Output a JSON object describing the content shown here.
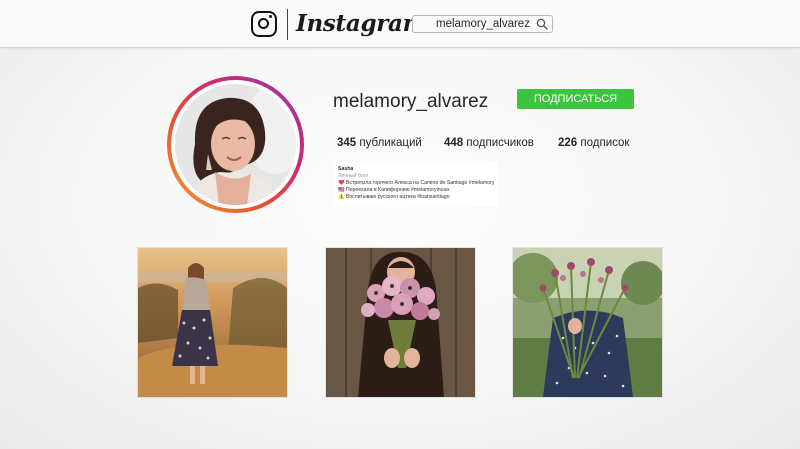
{
  "header": {
    "logo_icon": "instagram-camera-icon",
    "wordmark": "Instagram",
    "search": {
      "value": "melamory_alvarez",
      "icon": "search-icon"
    }
  },
  "profile": {
    "username": "melamory_alvarez",
    "follow_label": "ПОДПИСАТЬСЯ",
    "follow_color": "#3cc43f",
    "avatar_ring_colors": [
      "#f3a13b",
      "#e8542f",
      "#cf2872",
      "#8e3ab2"
    ],
    "stats": {
      "posts_count": "345",
      "posts_label": "публикаций",
      "followers_count": "448",
      "followers_label": "подписчиков",
      "following_count": "226",
      "following_label": "подписок"
    },
    "bio": {
      "name": "Sasha",
      "category": "Личный блог",
      "lines": [
        "❤️ Встретила горячего Алекса на Camino de Santiago #melamorylove",
        "🇺🇸 Переехала в Калифорнию #melamoryinusa",
        "⚠️ Воспитываю русского ацтека #loansantiago"
      ]
    }
  },
  "posts": [
    {
      "id": "post-1",
      "description_icon": "photo-icon"
    },
    {
      "id": "post-2",
      "description_icon": "photo-icon"
    },
    {
      "id": "post-3",
      "description_icon": "photo-icon"
    }
  ]
}
